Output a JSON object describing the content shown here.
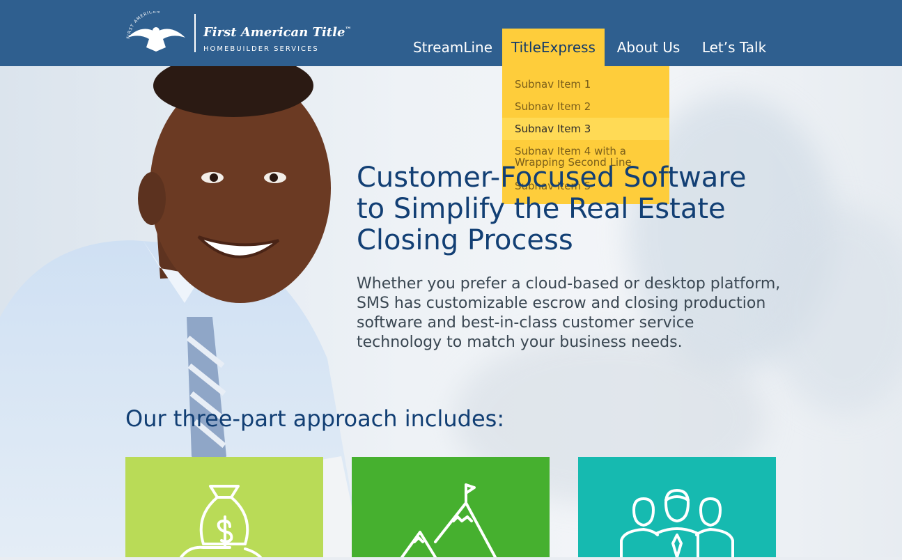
{
  "header": {
    "logo_ring_text": "FIRST AMERICAN",
    "logo_title": "First American Title",
    "logo_trademark": "™",
    "logo_subtitle": "HOMEBUILDER SERVICES"
  },
  "nav": {
    "items": [
      {
        "label": "StreamLine"
      },
      {
        "label": "TitleExpress"
      },
      {
        "label": "About Us"
      },
      {
        "label": "Let’s Talk"
      }
    ],
    "active_index": 1,
    "subnav": [
      {
        "label": "Subnav Item 1"
      },
      {
        "label": "Subnav Item 2"
      },
      {
        "label": "Subnav Item 3"
      },
      {
        "label": "Subnav Item 4 with a Wrapping Second Line"
      },
      {
        "label": "Subnav Item 5"
      }
    ],
    "hovered_subnav_index": 2
  },
  "hero": {
    "title": "Customer-Focused Software to Simplify the Real Estate Closing Process",
    "body": "Whether you prefer a cloud-based or desktop platform, SMS has customizable escrow and closing production software and best-in-class customer service technology to match your business needs."
  },
  "approach": {
    "heading": "Our three-part approach includes:",
    "cards": [
      {
        "icon": "money-bag-icon",
        "color": "#b9db57"
      },
      {
        "icon": "mountain-flag-icon",
        "color": "#46b02f"
      },
      {
        "icon": "team-people-icon",
        "color": "#16bab0"
      }
    ]
  },
  "colors": {
    "header_bg": "#2f5f8f",
    "nav_active": "#fecd3b",
    "title_blue": "#123f74"
  }
}
